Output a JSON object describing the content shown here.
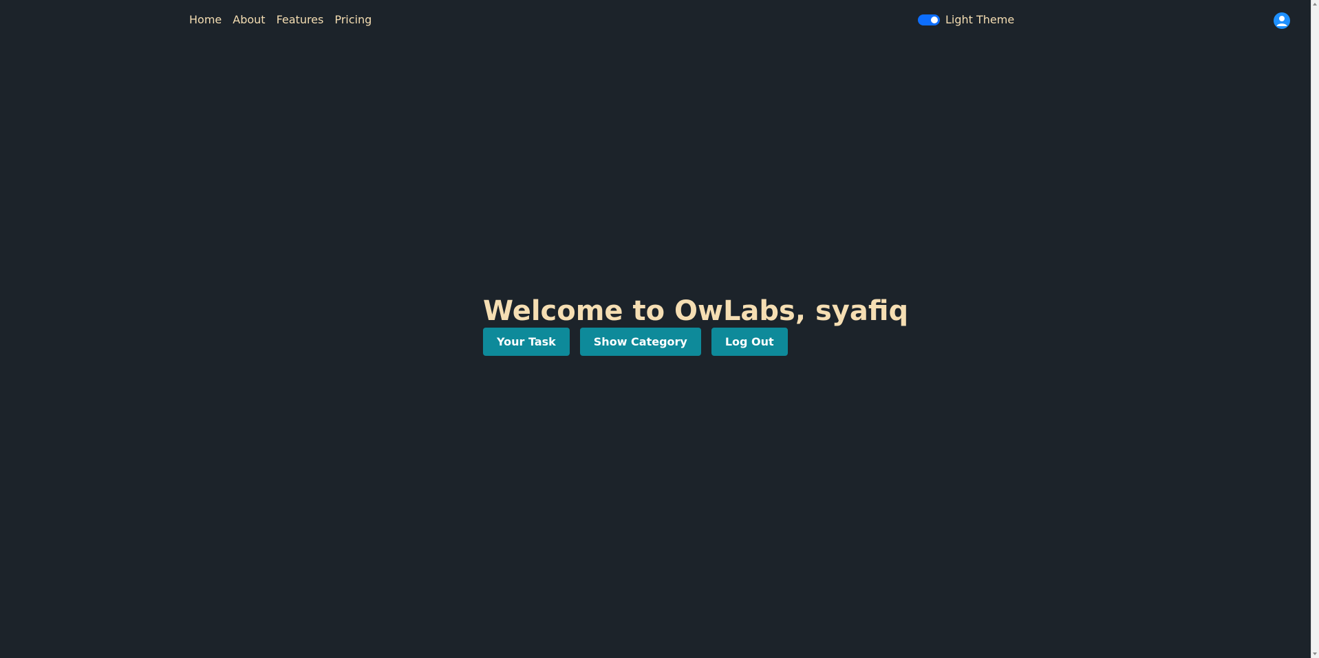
{
  "nav": {
    "links": [
      "Home",
      "About",
      "Features",
      "Pricing"
    ]
  },
  "theme_toggle": {
    "label": "Light Theme",
    "checked": true
  },
  "hero": {
    "title": "Welcome to OwLabs, syafiq"
  },
  "actions": {
    "your_task": "Your Task",
    "show_category": "Show Category",
    "log_out": "Log Out"
  },
  "icons": {
    "avatar": "user-circle-icon",
    "scroll_up": "chevron-up-icon",
    "scroll_down": "chevron-down-icon"
  },
  "colors": {
    "background": "#1c232a",
    "accent_text": "#f5deb3",
    "button": "#0e8a9a",
    "toggle": "#0d6efd",
    "avatar": "#1e90ff"
  }
}
